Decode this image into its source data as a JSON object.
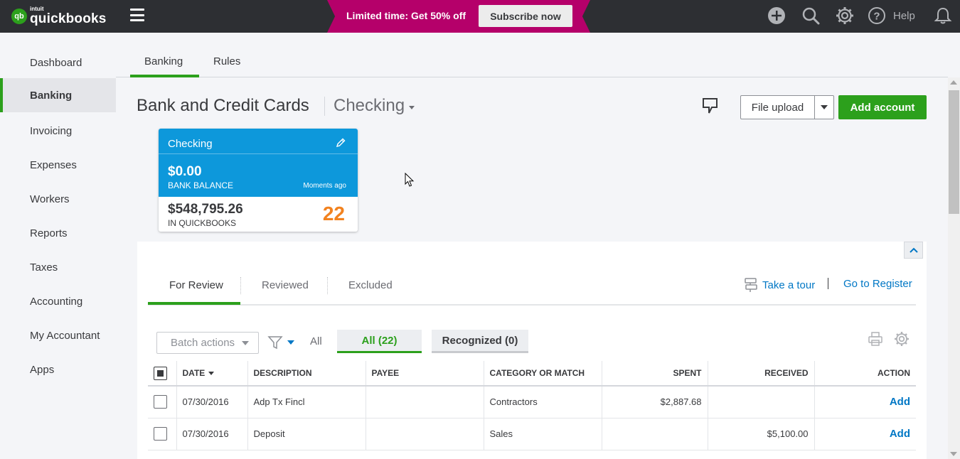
{
  "app": {
    "logo_badge": "qb",
    "logo_brand_small": "intuit",
    "logo_brand": "quickbooks"
  },
  "promo": {
    "text": "Limited time: Get 50% off",
    "button": "Subscribe now"
  },
  "topbar": {
    "help_label": "Help",
    "icons": [
      "plus-icon",
      "search-icon",
      "gear-icon",
      "help-icon",
      "bell-icon"
    ]
  },
  "sidebar": {
    "items": [
      {
        "label": "Dashboard",
        "active": false
      },
      {
        "label": "Banking",
        "active": true
      },
      {
        "label": "Invoicing",
        "active": false
      },
      {
        "label": "Expenses",
        "active": false
      },
      {
        "label": "Workers",
        "active": false
      },
      {
        "label": "Reports",
        "active": false
      },
      {
        "label": "Taxes",
        "active": false
      },
      {
        "label": "Accounting",
        "active": false
      },
      {
        "label": "My Accountant",
        "active": false
      },
      {
        "label": "Apps",
        "active": false
      }
    ]
  },
  "main_tabs": [
    {
      "label": "Banking",
      "active": true
    },
    {
      "label": "Rules",
      "active": false
    }
  ],
  "header": {
    "title": "Bank and Credit Cards",
    "account_selected": "Checking",
    "file_upload": "File upload",
    "add_account": "Add account"
  },
  "account_card": {
    "name": "Checking",
    "bank_balance": "$0.00",
    "bank_balance_label": "BANK BALANCE",
    "updated": "Moments ago",
    "qb_balance": "$548,795.26",
    "qb_balance_label": "IN QUICKBOOKS",
    "pending_count": "22"
  },
  "review_tabs": [
    {
      "label": "For Review",
      "active": true
    },
    {
      "label": "Reviewed",
      "active": false
    },
    {
      "label": "Excluded",
      "active": false
    }
  ],
  "links": {
    "tour": "Take a tour",
    "register": "Go to Register"
  },
  "toolbar": {
    "batch_actions": "Batch actions",
    "all_label": "All",
    "pill_all": "All (22)",
    "pill_recognized": "Recognized (0)"
  },
  "table": {
    "columns": [
      "DATE",
      "DESCRIPTION",
      "PAYEE",
      "CATEGORY OR MATCH",
      "SPENT",
      "RECEIVED",
      "ACTION"
    ],
    "rows": [
      {
        "date": "07/30/2016",
        "description": "Adp Tx Fincl",
        "payee": "",
        "category": "Contractors",
        "spent": "$2,887.68",
        "received": "",
        "action": "Add"
      },
      {
        "date": "07/30/2016",
        "description": "Deposit",
        "payee": "",
        "category": "Sales",
        "spent": "",
        "received": "$5,100.00",
        "action": "Add"
      }
    ]
  },
  "colors": {
    "brand_green": "#2ca01c",
    "link_blue": "#0077c5",
    "promo_magenta": "#b5006a",
    "card_blue": "#0d98db",
    "count_orange": "#f2821f"
  }
}
